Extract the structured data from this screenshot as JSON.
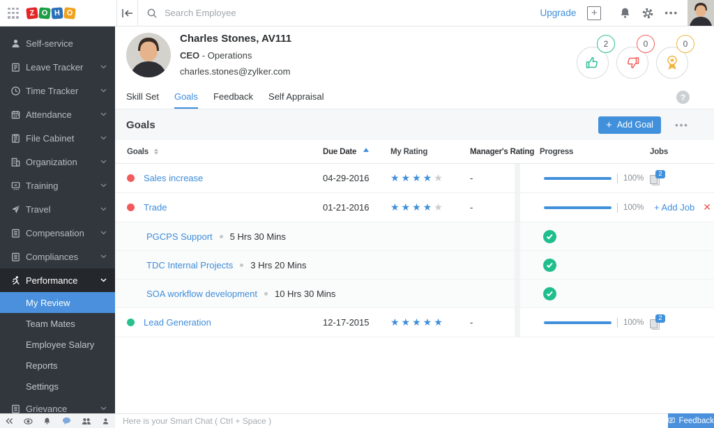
{
  "topbar": {
    "logo_letters": [
      "Z",
      "O",
      "H",
      "O"
    ],
    "logo_colors": [
      "#e42527",
      "#1d9d48",
      "#2a6fba",
      "#f0a11e"
    ],
    "search_placeholder": "Search Employee",
    "upgrade_label": "Upgrade"
  },
  "sidebar": {
    "items": [
      {
        "label": "Self-service"
      },
      {
        "label": "Leave Tracker"
      },
      {
        "label": "Time Tracker"
      },
      {
        "label": "Attendance"
      },
      {
        "label": "File Cabinet"
      },
      {
        "label": "Organization"
      },
      {
        "label": "Training"
      },
      {
        "label": "Travel"
      },
      {
        "label": "Compensation"
      },
      {
        "label": "Compliances"
      },
      {
        "label": "Performance"
      },
      {
        "label": "Grievance"
      }
    ],
    "performance_children": [
      {
        "label": "My Review",
        "selected": true
      },
      {
        "label": "Team Mates"
      },
      {
        "label": "Employee Salary"
      },
      {
        "label": "Reports"
      },
      {
        "label": "Settings"
      }
    ]
  },
  "employee": {
    "name": "Charles Stones, AV111",
    "title": "CEO",
    "title_suffix": " - Operations",
    "email": "charles.stones@zylker.com",
    "badges": [
      {
        "name": "thumbs-up",
        "count": "2",
        "color": "#2cbf96"
      },
      {
        "name": "thumbs-down",
        "count": "0",
        "color": "#f2605e"
      },
      {
        "name": "award",
        "count": "0",
        "color": "#f0b541"
      }
    ]
  },
  "tabs": [
    {
      "label": "Skill Set"
    },
    {
      "label": "Goals"
    },
    {
      "label": "Feedback"
    },
    {
      "label": "Self Appraisal"
    }
  ],
  "goals_section": {
    "title": "Goals",
    "add_button_label": "Add Goal",
    "table": {
      "headers": [
        "Goals",
        "Due Date",
        "My Rating",
        "Manager's Rating",
        "Progress",
        "Jobs"
      ],
      "rows": [
        {
          "name": "Sales increase",
          "status_color": "#f25b5b",
          "due": "04-29-2016",
          "my_rating": 4,
          "manager_rating": "-",
          "progress": 100,
          "progress_label": "100%",
          "jobs_count": "2"
        },
        {
          "name": "Trade",
          "status_color": "#f25b5b",
          "due": "01-21-2016",
          "my_rating": 4,
          "manager_rating": "-",
          "progress": 100,
          "progress_label": "100%",
          "add_job_label": "+ Add Job"
        },
        {
          "name": "Lead Generation",
          "status_color": "#28c08b",
          "due": "12-17-2015",
          "my_rating": 5,
          "manager_rating": "-",
          "progress": 100,
          "progress_label": "100%",
          "jobs_count": "2"
        }
      ],
      "trade_subrows": [
        {
          "name": "PGCPS Support",
          "time": "5 Hrs 30 Mins"
        },
        {
          "name": "TDC Internal Projects",
          "time": "3 Hrs 20 Mins"
        },
        {
          "name": "SOA workflow development",
          "time": "10 Hrs 30 Mins"
        }
      ]
    }
  },
  "chatbar": {
    "placeholder": "Here is your Smart Chat ( Ctrl + Space )",
    "feedback_label": "Feedback"
  }
}
